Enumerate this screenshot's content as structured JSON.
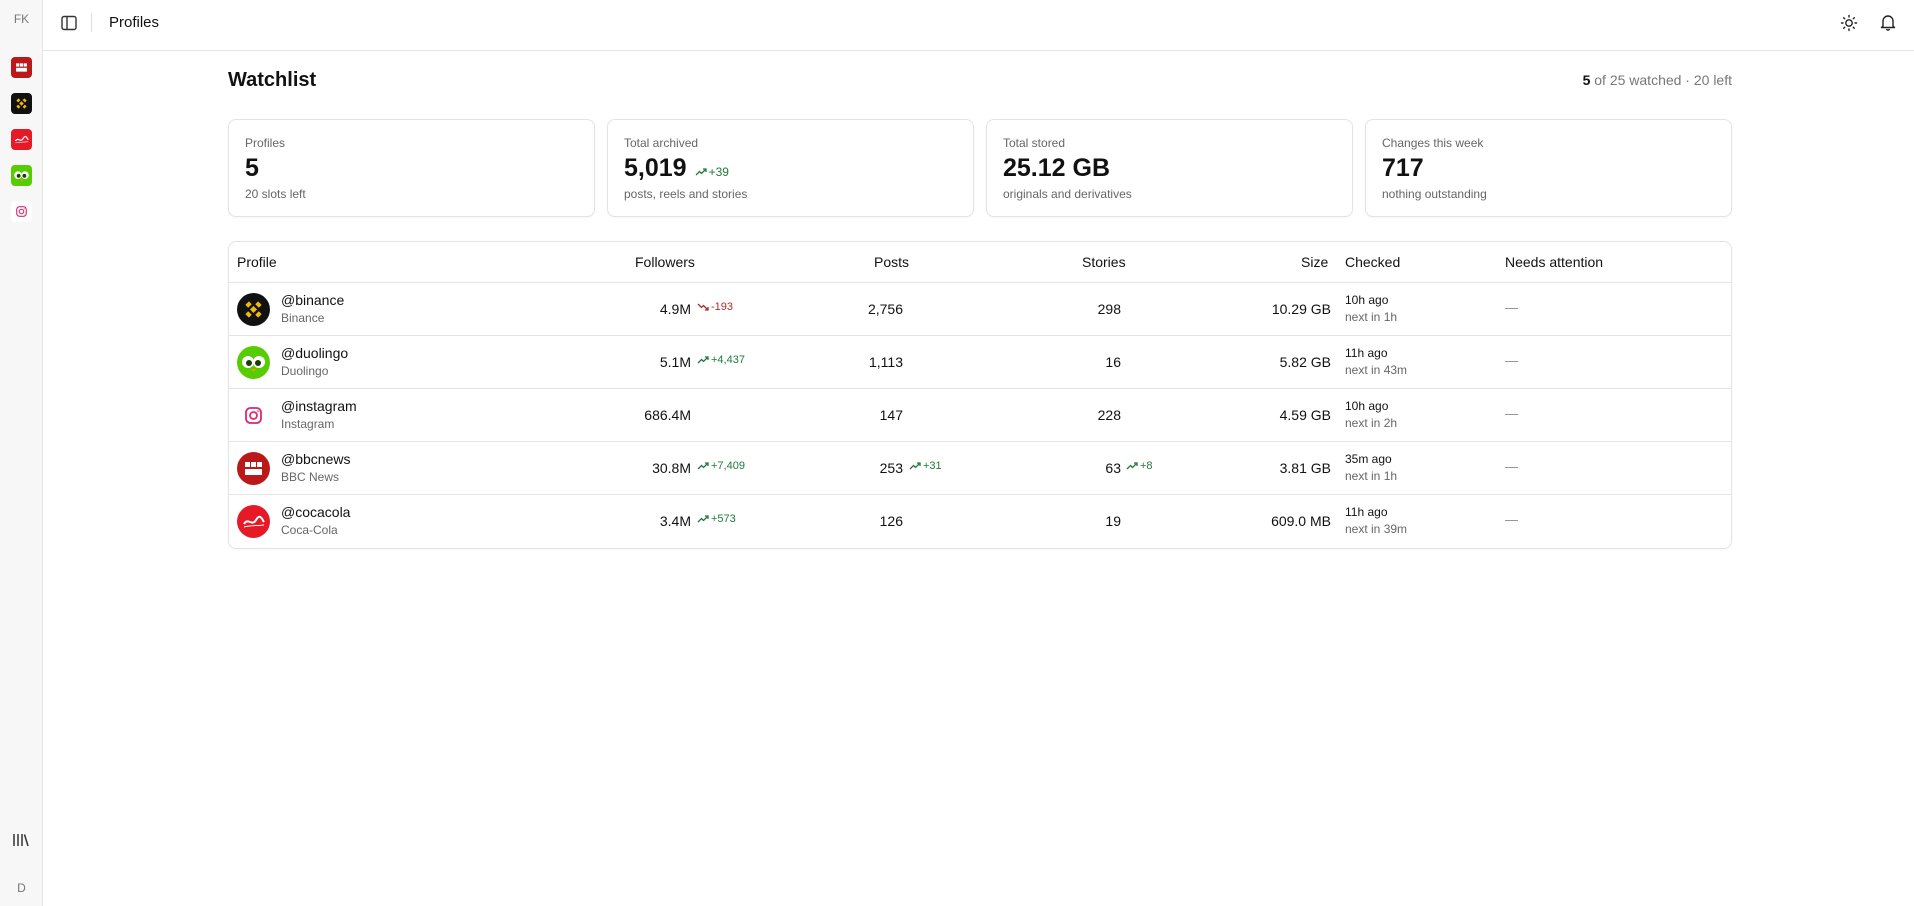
{
  "sidebar": {
    "initials": "FK",
    "profiles": [
      "bbcnews",
      "binance",
      "cocacola",
      "duolingo",
      "instagram"
    ],
    "bottom_icon": "library-icon",
    "user_initial": "D"
  },
  "topbar": {
    "title": "Profiles",
    "icons": [
      "panel-toggle-icon",
      "sun-icon",
      "bell-icon"
    ]
  },
  "header": {
    "title": "Watchlist",
    "quota_watched": "5",
    "quota_rest": " of 25 watched · 20 left"
  },
  "stats": [
    {
      "label": "Profiles",
      "value": "5",
      "delta": "",
      "sub": "20 slots left"
    },
    {
      "label": "Total archived",
      "value": "5,019",
      "delta": "+39",
      "sub": "posts, reels and stories"
    },
    {
      "label": "Total stored",
      "value": "25.12 GB",
      "delta": "",
      "sub": "originals and derivatives"
    },
    {
      "label": "Changes this week",
      "value": "717",
      "delta": "",
      "sub": "nothing outstanding"
    }
  ],
  "table": {
    "columns": [
      "Profile",
      "Followers",
      "Posts",
      "Stories",
      "Size",
      "Checked",
      "Needs attention"
    ],
    "rows": [
      {
        "handle": "@binance",
        "name": "Binance",
        "followers": "4.9M",
        "followers_delta": "-193",
        "followers_dir": "down",
        "posts": "2,756",
        "posts_delta": "",
        "stories": "298",
        "stories_delta": "",
        "size": "10.29 GB",
        "checked": "10h ago",
        "next": "next in 1h",
        "attention": "—"
      },
      {
        "handle": "@duolingo",
        "name": "Duolingo",
        "followers": "5.1M",
        "followers_delta": "+4,437",
        "followers_dir": "up",
        "posts": "1,113",
        "posts_delta": "",
        "stories": "16",
        "stories_delta": "",
        "size": "5.82 GB",
        "checked": "11h ago",
        "next": "next in 43m",
        "attention": "—"
      },
      {
        "handle": "@instagram",
        "name": "Instagram",
        "followers": "686.4M",
        "followers_delta": "",
        "followers_dir": "",
        "posts": "147",
        "posts_delta": "",
        "stories": "228",
        "stories_delta": "",
        "size": "4.59 GB",
        "checked": "10h ago",
        "next": "next in 2h",
        "attention": "—"
      },
      {
        "handle": "@bbcnews",
        "name": "BBC News",
        "followers": "30.8M",
        "followers_delta": "+7,409",
        "followers_dir": "up",
        "posts": "253",
        "posts_delta": "+31",
        "stories": "63",
        "stories_delta": "+8",
        "size": "3.81 GB",
        "checked": "35m ago",
        "next": "next in 1h",
        "attention": "—"
      },
      {
        "handle": "@cocacola",
        "name": "Coca-Cola",
        "followers": "3.4M",
        "followers_delta": "+573",
        "followers_dir": "up",
        "posts": "126",
        "posts_delta": "",
        "stories": "19",
        "stories_delta": "",
        "size": "609.0 MB",
        "checked": "11h ago",
        "next": "next in 39m",
        "attention": "—"
      }
    ]
  },
  "colors": {
    "up": "#1f7a3a",
    "down": "#b02a2a",
    "border": "#e3e3e3"
  }
}
